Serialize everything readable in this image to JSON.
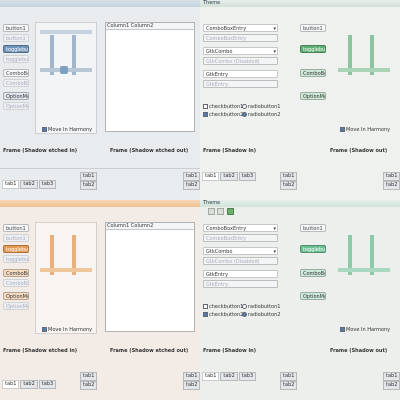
{
  "theme_title": "Theme",
  "buttons": {
    "button1": "button1",
    "togglebutton1": "togglebutton1",
    "combobox": "ComboBox",
    "optionmenu": "OptionMenu"
  },
  "combos": {
    "comboboxentry": "ComboBoxEntry",
    "comboboxentry_disabled": "ComboBoxEntry",
    "gtkcombo": "GtkCombo",
    "gtkcombo_disabled": "GtkCombo (Disabled)",
    "gtkentry": "GtkEntry",
    "gtkentry_disabled": "GtkEntry"
  },
  "list_header": "Column1 Column2",
  "checks": {
    "checkbutton1": "checkbutton1",
    "radiobutton1": "radiobutton1",
    "checkbutton2": "checkbutton2",
    "radiobutton2": "radiobutton2"
  },
  "move_harmony": "Move In Harmony",
  "frames": {
    "etched_in": "Frame (Shadow etched in)",
    "etched_out": "Frame (Shadow etched out)",
    "shadow_in": "Frame (Shadow in)",
    "shadow_out": "Frame (Shadow out)"
  },
  "tabs": [
    "tab1",
    "tab2",
    "tab3"
  ],
  "accents": {
    "blue": "#5b86b8",
    "green": "#3fa060",
    "orange": "#e08a3a",
    "teal": "#58aa8a"
  }
}
